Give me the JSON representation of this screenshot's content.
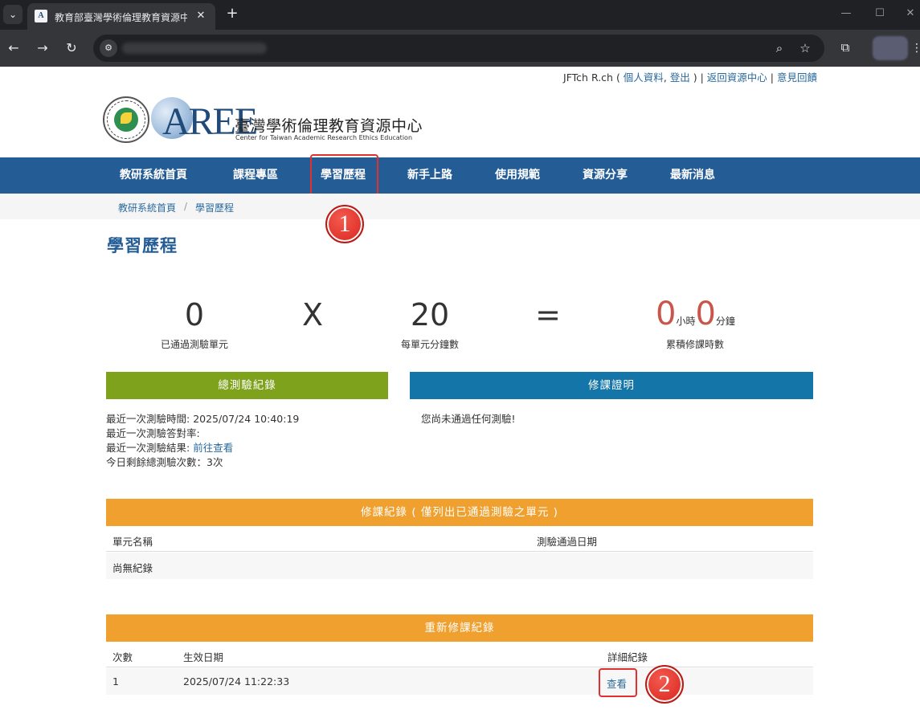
{
  "browser": {
    "tab_title": "教育部臺灣學術倫理教育資源中",
    "tab_favicon": "A",
    "new_tab": "+",
    "close": "✕"
  },
  "userbar": {
    "user_name": "JFTch R.ch",
    "open_paren": " ( ",
    "profile_link": "個人資料",
    "comma": ", ",
    "logout_link": "登出",
    "close_paren": " ) | ",
    "back_link": "返回資源中心",
    "sep": " | ",
    "feedback_link": "意見回饋"
  },
  "logo": {
    "aree": "AREE",
    "zh_name": "臺灣學術倫理教育資源中心",
    "en_name": "Center for Taiwan Academic Research Ethics Education"
  },
  "nav": {
    "items": [
      "教研系統首頁",
      "課程專區",
      "學習歷程",
      "新手上路",
      "使用規範",
      "資源分享",
      "最新消息"
    ]
  },
  "annotations": {
    "badge_1": "1",
    "badge_2": "2"
  },
  "breadcrumb": {
    "home": "教研系統首頁",
    "separator": "/",
    "current": "學習歷程"
  },
  "page_title": "學習歷程",
  "stats": {
    "passed_units": "0",
    "passed_units_label": "已通過測驗單元",
    "times": "X",
    "minutes_per_unit": "20",
    "minutes_per_unit_label": "每單元分鐘數",
    "equals": "=",
    "hours": "0",
    "hours_unit": "小時",
    "minutes": "0",
    "minutes_unit": "分鐘",
    "total_label": "累積修課時數"
  },
  "test_panel": {
    "title": "總測驗紀錄",
    "last_time_label": "最近一次測驗時間: ",
    "last_time_value": "2025/07/24 10:40:19",
    "last_accuracy_label": "最近一次測驗答對率:",
    "last_result_label": "最近一次測驗結果: ",
    "last_result_link": "前往查看",
    "remaining_label": "今日剩餘總測驗次數：",
    "remaining_value": "3次"
  },
  "certificate_panel": {
    "title": "修課證明",
    "message": "您尚未通過任何測驗!"
  },
  "course_record": {
    "title": "修課紀錄 ( 僅列出已通過測驗之單元 )",
    "col_unit": "單元名稱",
    "col_date": "測驗通過日期",
    "empty": "尚無紀錄"
  },
  "retake_record": {
    "title": "重新修課紀錄",
    "col_count": "次數",
    "col_date": "生效日期",
    "col_detail": "詳細紀錄",
    "rows": [
      {
        "count": "1",
        "date": "2025/07/24 11:22:33",
        "detail": "查看"
      }
    ]
  },
  "colors": {
    "nav_blue": "#245c96",
    "green_header": "#7fa21d",
    "teal_header": "#1475a8",
    "orange_header": "#f0a02e",
    "annotation_red": "#e03030",
    "stat_red": "#c9564b"
  }
}
